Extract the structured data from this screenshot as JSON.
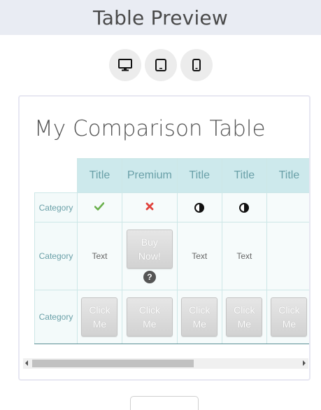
{
  "header": {
    "title": "Table Preview"
  },
  "device_switch": {
    "desktop_icon": "monitor-icon",
    "tablet_icon": "tablet-icon",
    "phone_icon": "phone-icon"
  },
  "preview": {
    "title": "My Comparison Table",
    "columns": [
      "Title",
      "Premium",
      "Title",
      "Title",
      "Title"
    ],
    "rows": [
      {
        "category": "Category",
        "cells": [
          "check",
          "cross",
          "half",
          "half",
          ""
        ]
      },
      {
        "category": "Category",
        "cells": [
          "Text",
          "Buy Now!",
          "Text",
          "Text",
          ""
        ]
      },
      {
        "category": "Category",
        "cells": [
          "Click Me",
          "Click Me",
          "Click Me",
          "Click Me",
          "Click Me"
        ]
      }
    ],
    "buy_button": {
      "line1": "Buy",
      "line2": "Now!"
    },
    "help_glyph": "?",
    "click_button": {
      "line1": "Click",
      "line2": "Me"
    },
    "text_value": "Text",
    "colors": {
      "header_bg": "#cde9ec",
      "header_text": "#6aa0a8",
      "check": "#6ab04c",
      "cross": "#e0413b",
      "bottom_border": "#5b8f95"
    }
  },
  "scrollbar": {
    "thumb_fraction": 0.57
  }
}
